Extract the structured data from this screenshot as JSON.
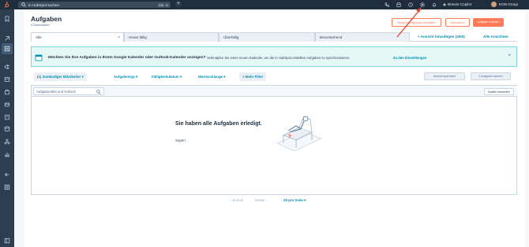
{
  "topbar": {
    "search_placeholder": "In HubSpot suchen",
    "shortcut_ctrl": "Ctrl",
    "shortcut_key": "K",
    "add_label": "+",
    "copilot_label": "Breeze Copilot",
    "account_name": "KON Group"
  },
  "header": {
    "title": "Aufgaben",
    "subtitle": "0 Datensätze",
    "btn_notifications": "Benachrichtigungen einstellen",
    "btn_start_queue": "Importieren",
    "btn_create": "Aufgabe erstellen"
  },
  "tabs": [
    {
      "label": "Alle",
      "closable": true
    },
    {
      "label": "Heute fällig",
      "closable": false
    },
    {
      "label": "Überfällig",
      "closable": false
    },
    {
      "label": "Bevorstehend",
      "closable": false
    }
  ],
  "views": {
    "add_view": "+ Ansicht hinzufügen (4/50)",
    "all_views": "Alle Ansichten"
  },
  "banner": {
    "title": "Möchten Sie Ihre Aufgaben in Ihrem Google Kalender oder Outlook-Kalender anzeigen?",
    "text": "Verknüpfen Sie einen neuen Kalender, um die in HubSpot erstellten Aufgaben zu synchronisieren.",
    "link": "Zu den Einstellungen",
    "close": "×"
  },
  "filters": {
    "assignee": "(1) Zuständiger Mitarbeiter ▾",
    "task_type": "Aufgabentyp ▾",
    "due_date": "Fälligkeitsdatum ▾",
    "queues": "Warteschlange ▾",
    "more": "≡ Mehr Filter",
    "save_view": "Ansicht speichern",
    "start_tasks": "0 Aufgaben starten"
  },
  "table": {
    "search_placeholder": "Aufgabentitel und Notizen",
    "edit_columns": "Spalten bearbeiten",
    "empty_title": "Sie haben alle Aufgaben erledigt.",
    "empty_sub": "Super!"
  },
  "pagination": {
    "prev": "‹ Zurück",
    "next": "Weiter ›",
    "per_page": "25 pro Seite ▾"
  },
  "colors": {
    "accent": "#ff7a59",
    "link": "#0091ae",
    "topbar": "#1f2d3d",
    "sidebar": "#2d3e50",
    "banner_bg": "#e5f8f6",
    "arrow": "#e0442c"
  },
  "icons": {
    "top_right": [
      "phone-icon",
      "marketplace-icon",
      "help-icon",
      "settings-icon",
      "bell-icon"
    ],
    "sidebar": [
      "bookmark-icon",
      "workspaces-icon",
      "contacts-icon",
      "marketing-icon",
      "content-icon",
      "sales-icon",
      "commerce-icon",
      "service-icon",
      "data-icon",
      "automation-icon",
      "reporting-icon",
      "library-icon",
      "collapse-icon"
    ]
  }
}
